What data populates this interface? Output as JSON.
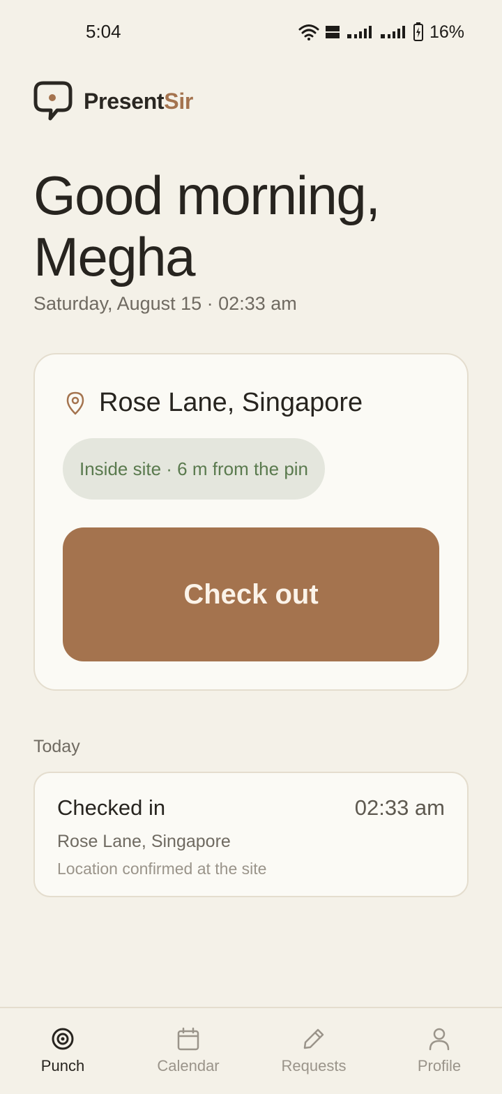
{
  "status_bar": {
    "time": "5:04",
    "battery_text": "16%"
  },
  "brand": {
    "name_part1": "Present",
    "name_part2": "Sir",
    "accent_color": "#a4734e"
  },
  "greeting": {
    "line": "Good morning, Megha",
    "date_time": "Saturday, August 15 · 02:33 am"
  },
  "punch_card": {
    "site_name": "Rose Lane, Singapore",
    "site_icon": "location-pin-icon",
    "geofence_status": "Inside site · 6 m from the pin",
    "action_label": "Check out"
  },
  "today": {
    "section_label": "Today",
    "entries": [
      {
        "title": "Checked in",
        "time": "02:33 am",
        "location": "Rose Lane, Singapore",
        "note": "Location confirmed at the site"
      }
    ]
  },
  "nav": {
    "items": [
      {
        "label": "Punch",
        "icon": "target-icon",
        "active": true
      },
      {
        "label": "Calendar",
        "icon": "calendar-icon",
        "active": false
      },
      {
        "label": "Requests",
        "icon": "pencil-icon",
        "active": false
      },
      {
        "label": "Profile",
        "icon": "person-icon",
        "active": false
      }
    ]
  }
}
